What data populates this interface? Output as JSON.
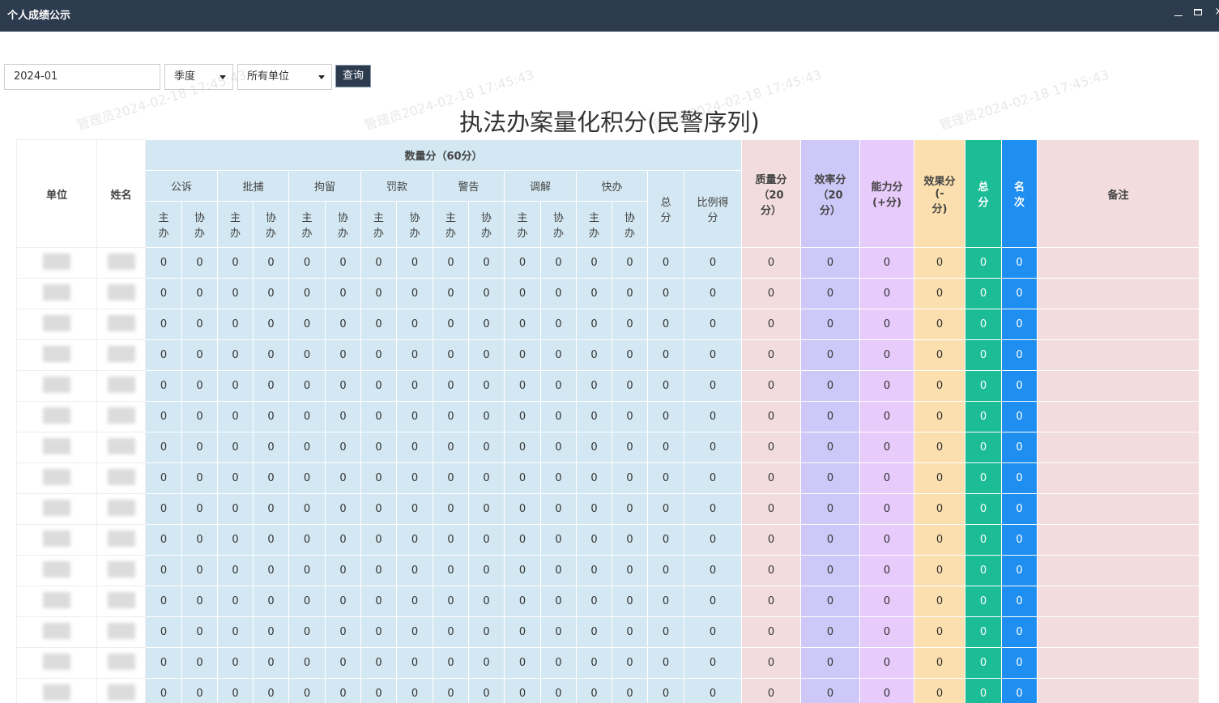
{
  "window": {
    "title": "个人成绩公示"
  },
  "filters": {
    "date_value": "2024-01",
    "period_value": "季度",
    "unit_value": "所有单位",
    "search_label": "查询"
  },
  "page_title": "执法办案量化积分(民警序列)",
  "watermark_text": "管理员2024-02-18 17:45:43",
  "table": {
    "headers": {
      "unit": "单位",
      "name": "姓名",
      "quantity": "数量分（60分）",
      "categories": [
        "公诉",
        "批捕",
        "拘留",
        "罚款",
        "警告",
        "调解",
        "快办"
      ],
      "main": "主\n办",
      "assist": "协\n办",
      "sub_total": "总\n分",
      "ratio": "比例得\n分",
      "quality": "质量分\n（20\n分）",
      "efficiency": "效率分\n（20\n分）",
      "ability": "能力分\n(+分)",
      "effect": "效果分\n(-\n分)",
      "total": "总\n分",
      "rank": "名\n次",
      "remarks": "备注"
    },
    "rows": [
      [
        "0",
        "0",
        "0",
        "0",
        "0",
        "0",
        "0",
        "0",
        "0",
        "0",
        "0",
        "0",
        "0",
        "0",
        "0",
        "0",
        "0",
        "0",
        "0",
        "0",
        "0",
        "0"
      ],
      [
        "0",
        "0",
        "0",
        "0",
        "0",
        "0",
        "0",
        "0",
        "0",
        "0",
        "0",
        "0",
        "0",
        "0",
        "0",
        "0",
        "0",
        "0",
        "0",
        "0",
        "0",
        "0"
      ],
      [
        "0",
        "0",
        "0",
        "0",
        "0",
        "0",
        "0",
        "0",
        "0",
        "0",
        "0",
        "0",
        "0",
        "0",
        "0",
        "0",
        "0",
        "0",
        "0",
        "0",
        "0",
        "0"
      ],
      [
        "0",
        "0",
        "0",
        "0",
        "0",
        "0",
        "0",
        "0",
        "0",
        "0",
        "0",
        "0",
        "0",
        "0",
        "0",
        "0",
        "0",
        "0",
        "0",
        "0",
        "0",
        "0"
      ],
      [
        "0",
        "0",
        "0",
        "0",
        "0",
        "0",
        "0",
        "0",
        "0",
        "0",
        "0",
        "0",
        "0",
        "0",
        "0",
        "0",
        "0",
        "0",
        "0",
        "0",
        "0",
        "0"
      ],
      [
        "0",
        "0",
        "0",
        "0",
        "0",
        "0",
        "0",
        "0",
        "0",
        "0",
        "0",
        "0",
        "0",
        "0",
        "0",
        "0",
        "0",
        "0",
        "0",
        "0",
        "0",
        "0"
      ],
      [
        "0",
        "0",
        "0",
        "0",
        "0",
        "0",
        "0",
        "0",
        "0",
        "0",
        "0",
        "0",
        "0",
        "0",
        "0",
        "0",
        "0",
        "0",
        "0",
        "0",
        "0",
        "0"
      ],
      [
        "0",
        "0",
        "0",
        "0",
        "0",
        "0",
        "0",
        "0",
        "0",
        "0",
        "0",
        "0",
        "0",
        "0",
        "0",
        "0",
        "0",
        "0",
        "0",
        "0",
        "0",
        "0"
      ],
      [
        "0",
        "0",
        "0",
        "0",
        "0",
        "0",
        "0",
        "0",
        "0",
        "0",
        "0",
        "0",
        "0",
        "0",
        "0",
        "0",
        "0",
        "0",
        "0",
        "0",
        "0",
        "0"
      ],
      [
        "0",
        "0",
        "0",
        "0",
        "0",
        "0",
        "0",
        "0",
        "0",
        "0",
        "0",
        "0",
        "0",
        "0",
        "0",
        "0",
        "0",
        "0",
        "0",
        "0",
        "0",
        "0"
      ],
      [
        "0",
        "0",
        "0",
        "0",
        "0",
        "0",
        "0",
        "0",
        "0",
        "0",
        "0",
        "0",
        "0",
        "0",
        "0",
        "0",
        "0",
        "0",
        "0",
        "0",
        "0",
        "0"
      ],
      [
        "0",
        "0",
        "0",
        "0",
        "0",
        "0",
        "0",
        "0",
        "0",
        "0",
        "0",
        "0",
        "0",
        "0",
        "0",
        "0",
        "0",
        "0",
        "0",
        "0",
        "0",
        "0"
      ],
      [
        "0",
        "0",
        "0",
        "0",
        "0",
        "0",
        "0",
        "0",
        "0",
        "0",
        "0",
        "0",
        "0",
        "0",
        "0",
        "0",
        "0",
        "0",
        "0",
        "0",
        "0",
        "0"
      ],
      [
        "0",
        "0",
        "0",
        "0",
        "0",
        "0",
        "0",
        "0",
        "0",
        "0",
        "0",
        "0",
        "0",
        "0",
        "0",
        "0",
        "0",
        "0",
        "0",
        "0",
        "0",
        "0"
      ],
      [
        "0",
        "0",
        "0",
        "0",
        "0",
        "0",
        "0",
        "0",
        "0",
        "0",
        "0",
        "0",
        "0",
        "0",
        "0",
        "0",
        "0",
        "0",
        "0",
        "0",
        "0",
        "0"
      ]
    ]
  },
  "colors": {
    "titlebar": "#2d3b4f",
    "quantity_bg": "#d3e8f2",
    "quality_bg": "#f2dcde",
    "efficiency_bg": "#cdc8f7",
    "ability_bg": "#e7cbfb",
    "effect_bg": "#fbdfae",
    "total_bg": "#1cbc97",
    "rank_bg": "#1e8ef0"
  }
}
